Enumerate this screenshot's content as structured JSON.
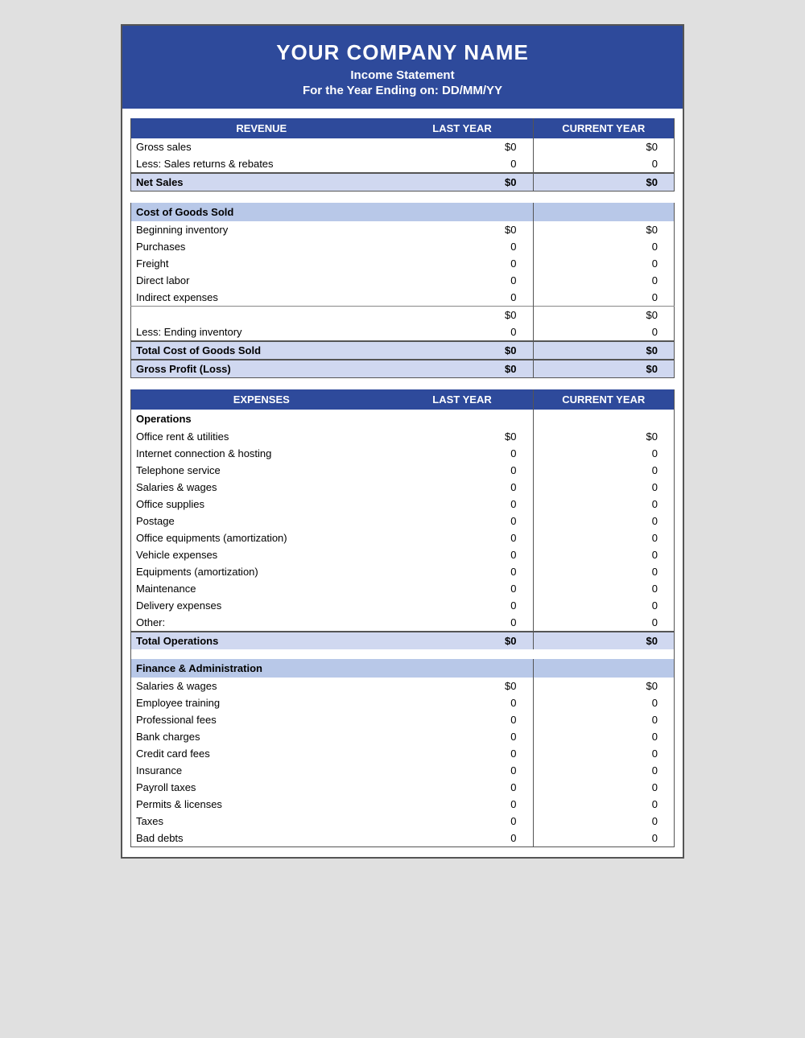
{
  "header": {
    "company": "YOUR COMPANY NAME",
    "title": "Income Statement",
    "period": "For the Year Ending on: DD/MM/YY"
  },
  "revenue": {
    "section_label": "REVENUE",
    "col_last": "LAST YEAR",
    "col_current": "CURRENT YEAR",
    "rows": [
      {
        "label": "Gross sales",
        "last": "$0",
        "current": "$0"
      },
      {
        "label": "Less: Sales returns & rebates",
        "last": "0",
        "current": "0"
      }
    ],
    "total_label": "Net Sales",
    "total_last": "$0",
    "total_current": "$0"
  },
  "cogs": {
    "section_label": "Cost of Goods Sold",
    "rows": [
      {
        "label": "Beginning inventory",
        "last": "$0",
        "current": "$0"
      },
      {
        "label": "Purchases",
        "last": "0",
        "current": "0"
      },
      {
        "label": "Freight",
        "last": "0",
        "current": "0"
      },
      {
        "label": "Direct labor",
        "last": "0",
        "current": "0"
      },
      {
        "label": "Indirect expenses",
        "last": "0",
        "current": "0"
      }
    ],
    "subtotal_last": "$0",
    "subtotal_current": "$0",
    "ending_label": "Less: Ending inventory",
    "ending_last": "0",
    "ending_current": "0",
    "total_label": "Total Cost of Goods Sold",
    "total_last": "$0",
    "total_current": "$0",
    "gross_label": "Gross Profit (Loss)",
    "gross_last": "$0",
    "gross_current": "$0"
  },
  "expenses": {
    "section_label": "EXPENSES",
    "col_last": "LAST YEAR",
    "col_current": "CURRENT YEAR",
    "operations": {
      "label": "Operations",
      "rows": [
        {
          "label": "Office rent & utilities",
          "last": "$0",
          "current": "$0"
        },
        {
          "label": "Internet connection & hosting",
          "last": "0",
          "current": "0"
        },
        {
          "label": "Telephone service",
          "last": "0",
          "current": "0"
        },
        {
          "label": "Salaries & wages",
          "last": "0",
          "current": "0"
        },
        {
          "label": "Office supplies",
          "last": "0",
          "current": "0"
        },
        {
          "label": "Postage",
          "last": "0",
          "current": "0"
        },
        {
          "label": "Office equipments (amortization)",
          "last": "0",
          "current": "0"
        },
        {
          "label": "Vehicle expenses",
          "last": "0",
          "current": "0"
        },
        {
          "label": "Equipments (amortization)",
          "last": "0",
          "current": "0"
        },
        {
          "label": "Maintenance",
          "last": "0",
          "current": "0"
        },
        {
          "label": "Delivery expenses",
          "last": "0",
          "current": "0"
        },
        {
          "label": "Other:",
          "last": "0",
          "current": "0"
        }
      ],
      "total_label": "Total Operations",
      "total_last": "$0",
      "total_current": "$0"
    },
    "finance": {
      "label": "Finance & Administration",
      "rows": [
        {
          "label": "Salaries & wages",
          "last": "$0",
          "current": "$0"
        },
        {
          "label": "Employee training",
          "last": "0",
          "current": "0"
        },
        {
          "label": "Professional fees",
          "last": "0",
          "current": "0"
        },
        {
          "label": "Bank charges",
          "last": "0",
          "current": "0"
        },
        {
          "label": "Credit card fees",
          "last": "0",
          "current": "0"
        },
        {
          "label": "Insurance",
          "last": "0",
          "current": "0"
        },
        {
          "label": "Payroll taxes",
          "last": "0",
          "current": "0"
        },
        {
          "label": "Permits & licenses",
          "last": "0",
          "current": "0"
        },
        {
          "label": "Taxes",
          "last": "0",
          "current": "0"
        },
        {
          "label": "Bad debts",
          "last": "0",
          "current": "0"
        }
      ]
    }
  }
}
